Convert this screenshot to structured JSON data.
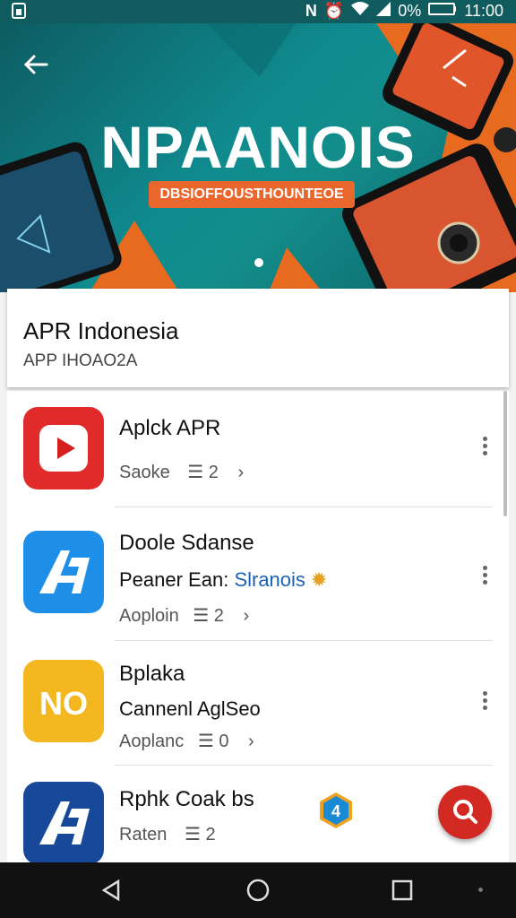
{
  "status_bar": {
    "battery_percent": "0%",
    "time": "11:00",
    "icons": [
      "sim-card-icon",
      "nfc-icon",
      "alarm-icon",
      "wifi-icon",
      "signal-icon",
      "battery-icon"
    ]
  },
  "hero": {
    "title": "NPAANOIS",
    "tagline": "DBSIOFFOUSTHOUNTEOE",
    "back_icon": "arrow-back-icon",
    "pager_dot_count": 1
  },
  "header_card": {
    "title": "APR Indonesia",
    "subtitle": "APP IHOAO2A"
  },
  "apps": [
    {
      "name": "Aplck APR",
      "line2": "",
      "meta_left": "Saoke",
      "meta_count": "2",
      "icon": "play-icon",
      "icon_color": "#e12a2a"
    },
    {
      "name": "Doole Sdanse",
      "line2_prefix": "Peaner Ean:",
      "line2_link": "Slranois",
      "meta_left": "Aoploin",
      "meta_count": "2",
      "icon": "ap-logo-icon",
      "icon_color": "#1e8fe8"
    },
    {
      "name": "Bplaka",
      "line2": "Cannenl AglSeo",
      "meta_left": "Aoplanc",
      "meta_count": "0",
      "icon": "no-logo-icon",
      "icon_color": "#f4b71f",
      "icon_text": "NO"
    },
    {
      "name": "Rphk Coak bs",
      "line2": "",
      "meta_left": "Raten",
      "meta_count": "2",
      "icon": "ap-logo-icon",
      "icon_color": "#18489a"
    }
  ],
  "fab": {
    "icon": "search-icon"
  },
  "nav": {
    "icons": [
      "back-triangle-icon",
      "home-circle-icon",
      "recents-square-icon"
    ]
  }
}
